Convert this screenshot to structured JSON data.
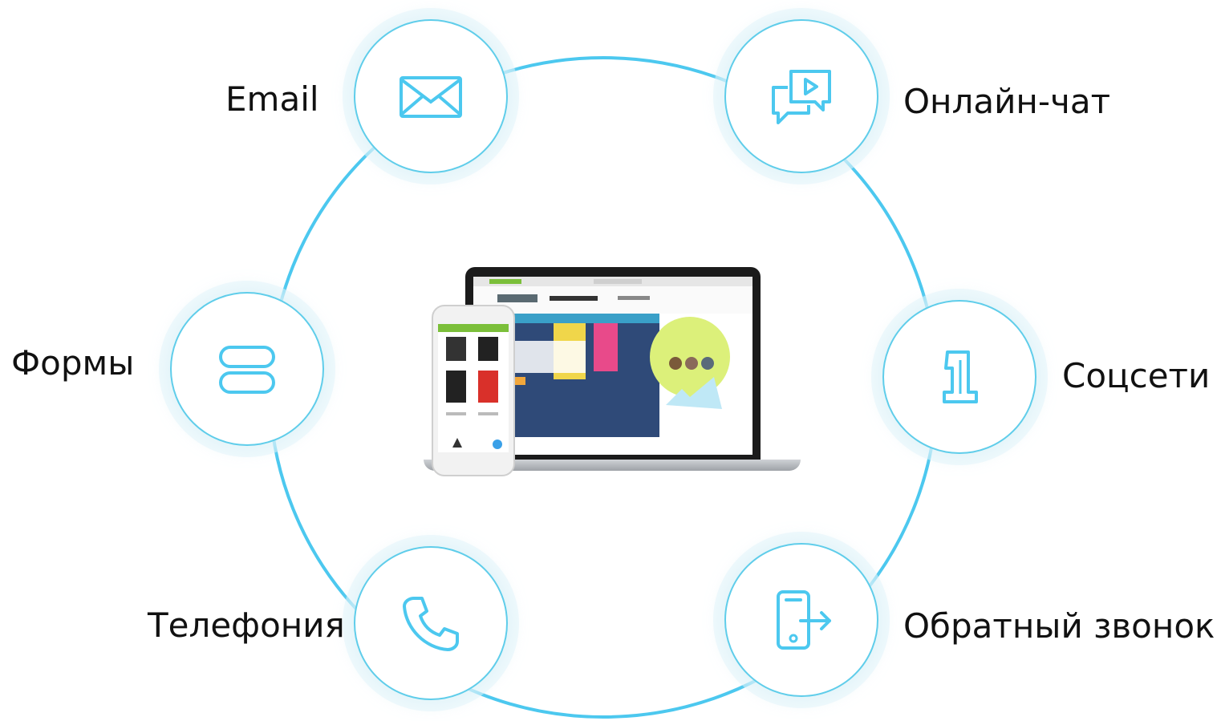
{
  "channels": {
    "email": {
      "label": "Email",
      "icon": "envelope-icon"
    },
    "chat": {
      "label": "Онлайн-чат",
      "icon": "chat-video-icon"
    },
    "forms": {
      "label": "Формы",
      "icon": "form-fields-icon"
    },
    "social": {
      "label": "Соцсети",
      "icon": "social-one-icon"
    },
    "phone": {
      "label": "Телефония",
      "icon": "phone-icon"
    },
    "callback": {
      "label": "Обратный звонок",
      "icon": "mobile-callback-icon"
    }
  },
  "center": {
    "image": "laptop-and-phone-store-mockup"
  },
  "colors": {
    "accent": "#4cc8ef",
    "text": "#111111",
    "lime": "#dcf07a"
  }
}
